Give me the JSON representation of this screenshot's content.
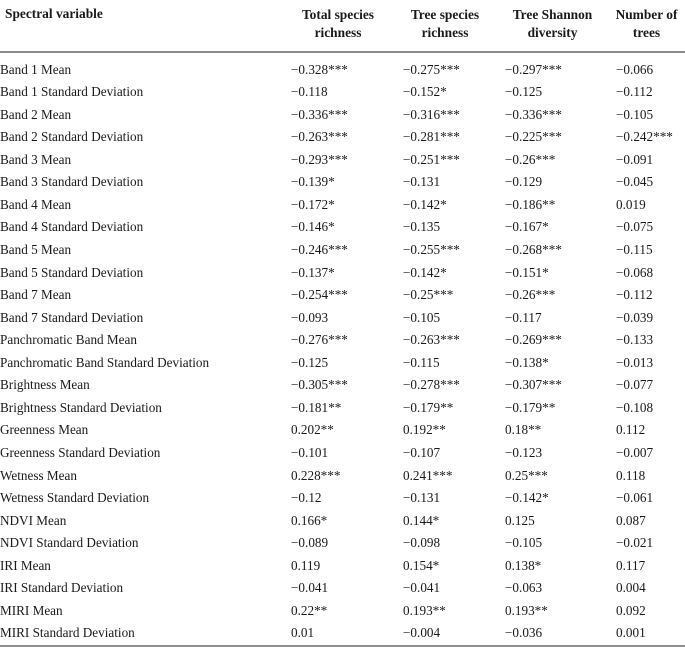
{
  "table": {
    "header": {
      "row_label": "Spectral variable",
      "columns": [
        {
          "line1": "Total species",
          "line2": "richness"
        },
        {
          "line1": "Tree species",
          "line2": "richness"
        },
        {
          "line1": "Tree Shannon",
          "line2": "diversity"
        },
        {
          "line1": "Number of",
          "line2": "trees"
        }
      ]
    },
    "rows": [
      {
        "label": "Band 1 Mean",
        "values": [
          "−0.328***",
          "−0.275***",
          "−0.297***",
          "−0.066"
        ]
      },
      {
        "label": "Band 1 Standard Deviation",
        "values": [
          "−0.118",
          "−0.152*",
          "−0.125",
          "−0.112"
        ]
      },
      {
        "label": "Band 2 Mean",
        "values": [
          "−0.336***",
          "−0.316***",
          "−0.336***",
          "−0.105"
        ]
      },
      {
        "label": "Band 2 Standard Deviation",
        "values": [
          "−0.263***",
          "−0.281***",
          "−0.225***",
          "−0.242***"
        ]
      },
      {
        "label": "Band 3 Mean",
        "values": [
          "−0.293***",
          "−0.251***",
          "−0.26***",
          "−0.091"
        ]
      },
      {
        "label": "Band 3 Standard Deviation",
        "values": [
          "−0.139*",
          "−0.131",
          "−0.129",
          "−0.045"
        ]
      },
      {
        "label": "Band 4 Mean",
        "values": [
          "−0.172*",
          "−0.142*",
          "−0.186**",
          "0.019"
        ]
      },
      {
        "label": "Band 4 Standard Deviation",
        "values": [
          "−0.146*",
          "−0.135",
          "−0.167*",
          "−0.075"
        ]
      },
      {
        "label": "Band 5 Mean",
        "values": [
          "−0.246***",
          "−0.255***",
          "−0.268***",
          "−0.115"
        ]
      },
      {
        "label": "Band 5 Standard Deviation",
        "values": [
          "−0.137*",
          "−0.142*",
          "−0.151*",
          "−0.068"
        ]
      },
      {
        "label": "Band 7 Mean",
        "values": [
          "−0.254***",
          "−0.25***",
          "−0.26***",
          "−0.112"
        ]
      },
      {
        "label": "Band 7 Standard Deviation",
        "values": [
          "−0.093",
          "−0.105",
          "−0.117",
          "−0.039"
        ]
      },
      {
        "label": "Panchromatic Band Mean",
        "values": [
          "−0.276***",
          "−0.263***",
          "−0.269***",
          "−0.133"
        ]
      },
      {
        "label": "Panchromatic Band Standard Deviation",
        "values": [
          "−0.125",
          "−0.115",
          "−0.138*",
          "−0.013"
        ]
      },
      {
        "label": "Brightness Mean",
        "values": [
          "−0.305***",
          "−0.278***",
          "−0.307***",
          "−0.077"
        ]
      },
      {
        "label": "Brightness Standard Deviation",
        "values": [
          "−0.181**",
          "−0.179**",
          "−0.179**",
          "−0.108"
        ]
      },
      {
        "label": "Greenness Mean",
        "values": [
          "0.202**",
          "0.192**",
          "0.18**",
          "0.112"
        ]
      },
      {
        "label": "Greenness Standard Deviation",
        "values": [
          "−0.101",
          "−0.107",
          "−0.123",
          "−0.007"
        ]
      },
      {
        "label": "Wetness Mean",
        "values": [
          "0.228***",
          "0.241***",
          "0.25***",
          "0.118"
        ]
      },
      {
        "label": "Wetness Standard Deviation",
        "values": [
          "−0.12",
          "−0.131",
          "−0.142*",
          "−0.061"
        ]
      },
      {
        "label": "NDVI Mean",
        "values": [
          "0.166*",
          "0.144*",
          "0.125",
          "0.087"
        ]
      },
      {
        "label": "NDVI Standard Deviation",
        "values": [
          "−0.089",
          "−0.098",
          "−0.105",
          "−0.021"
        ]
      },
      {
        "label": "IRI Mean",
        "values": [
          "0.119",
          "0.154*",
          "0.138*",
          "0.117"
        ]
      },
      {
        "label": "IRI Standard Deviation",
        "values": [
          "−0.041",
          "−0.041",
          "−0.063",
          "0.004"
        ]
      },
      {
        "label": "MIRI Mean",
        "values": [
          "0.22**",
          "0.193**",
          "0.193**",
          "0.092"
        ]
      },
      {
        "label": "MIRI Standard Deviation",
        "values": [
          "0.01",
          "−0.004",
          "−0.036",
          "0.001"
        ]
      }
    ]
  },
  "style": {
    "rule_color": "#8c8c8c",
    "text_color": "#1a1a1a",
    "background": "#ffffff"
  }
}
